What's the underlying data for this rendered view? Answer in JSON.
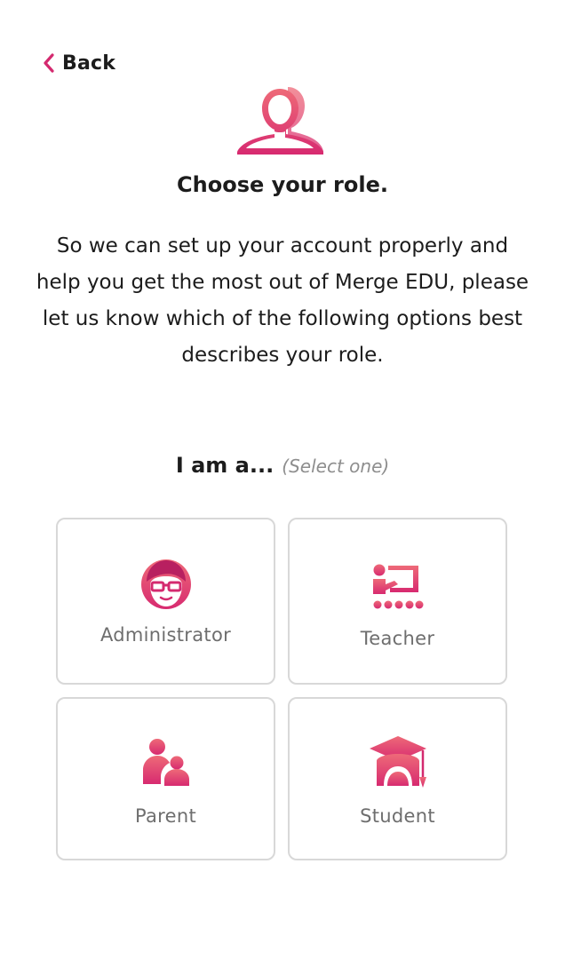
{
  "nav": {
    "back_label": "Back",
    "back_icon": "chevron-left-icon"
  },
  "header": {
    "icon": "users-icon",
    "title": "Choose your role."
  },
  "intro": {
    "text": "So we can set up your account properly and help you get the most out of Merge EDU, please let us know which of the following options best describes your role."
  },
  "prompt": {
    "main": "I am a...",
    "hint": "(Select one)"
  },
  "roles": [
    {
      "label": "Administrator",
      "icon": "administrator-icon"
    },
    {
      "label": "Teacher",
      "icon": "teacher-icon"
    },
    {
      "label": "Parent",
      "icon": "parent-icon"
    },
    {
      "label": "Student",
      "icon": "student-icon"
    }
  ],
  "colors": {
    "accent_start": "#ee5a75",
    "accent_end": "#d42a6f",
    "card_border": "#d8d8d8",
    "text_primary": "#1c1c1c",
    "text_muted": "#6e6e6e"
  }
}
